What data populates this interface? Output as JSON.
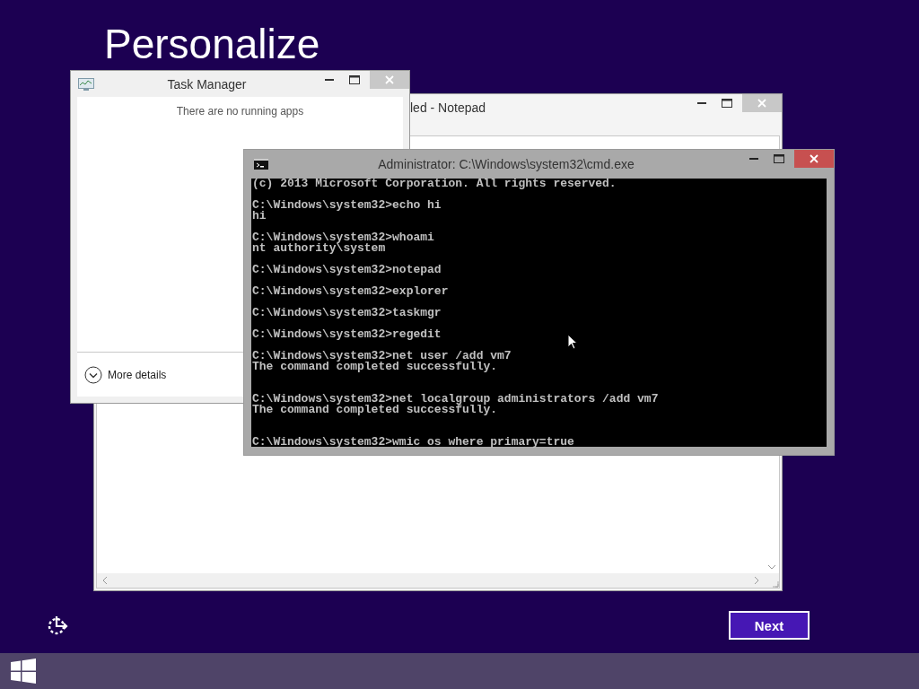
{
  "heading": "Personalize",
  "notepad": {
    "title": "led - Notepad"
  },
  "task_manager": {
    "title": "Task Manager",
    "message": "There are no running apps",
    "details_link": "More details"
  },
  "cmd": {
    "title": "Administrator: C:\\Windows\\system32\\cmd.exe",
    "output": "(c) 2013 Microsoft Corporation. All rights reserved.\n\nC:\\Windows\\system32>echo hi\nhi\n\nC:\\Windows\\system32>whoami\nnt authority\\system\n\nC:\\Windows\\system32>notepad\n\nC:\\Windows\\system32>explorer\n\nC:\\Windows\\system32>taskmgr\n\nC:\\Windows\\system32>regedit\n\nC:\\Windows\\system32>net user /add vm7\nThe command completed successfully.\n\n\nC:\\Windows\\system32>net localgroup administrators /add vm7\nThe command completed successfully.\n\n\nC:\\Windows\\system32>wmic os where primary=true"
  },
  "next_button": "Next"
}
